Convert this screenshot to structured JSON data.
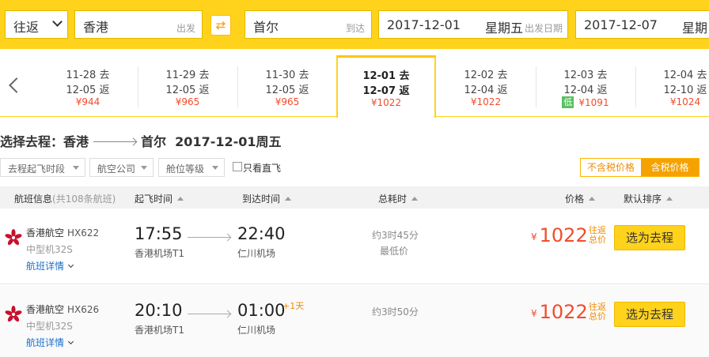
{
  "search": {
    "trip_type": "往返",
    "from_city": "香港",
    "from_hint": "出发",
    "to_city": "首尔",
    "to_hint": "到达",
    "depart_date": "2017-12-01",
    "depart_weekday": "星期五",
    "depart_hint": "出发日期",
    "return_date": "2017-12-07",
    "return_weekday": "星期",
    "colors": {
      "brand": "#ffd21c",
      "price": "#f24c2b",
      "accent": "#f5a200",
      "low_badge": "#5ac061"
    }
  },
  "date_strip": {
    "prev_icon": "chevron-left-icon",
    "cells": [
      {
        "go": "11-28 去",
        "ret": "12-05 返",
        "price": "¥944"
      },
      {
        "go": "11-29 去",
        "ret": "12-05 返",
        "price": "¥965"
      },
      {
        "go": "11-30 去",
        "ret": "12-05 返",
        "price": "¥965"
      },
      {
        "go": "12-01 去",
        "ret": "12-07 返",
        "price": "¥1022",
        "active": true
      },
      {
        "go": "12-02 去",
        "ret": "12-04 返",
        "price": "¥1022"
      },
      {
        "go": "12-03 去",
        "ret": "12-04 返",
        "price": "¥1091",
        "badge": "低"
      },
      {
        "go": "12-04 去",
        "ret": "12-10 返",
        "price": "¥1024"
      }
    ]
  },
  "route": {
    "prefix": "选择去程：香港",
    "to": "首尔",
    "date": "2017-12-01周五"
  },
  "filters": {
    "time": "去程起飞时段",
    "airline": "航空公司",
    "cabin": "舱位等级",
    "direct": "只看直飞",
    "tax_excl": "不含税价格",
    "tax_incl": "含税价格"
  },
  "table_header": {
    "flight": "航班信息",
    "flight_count": "(共108条航班)",
    "depart": "起飞时间",
    "arrive": "到达时间",
    "duration": "总耗时",
    "price": "价格",
    "sort": "默认排序"
  },
  "flights": [
    {
      "airline": "香港航空",
      "flight_no": "HX622",
      "plane": "中型机32S",
      "details": "航班详情",
      "dep_time": "17:55",
      "dep_airport": "香港机场T1",
      "arr_time": "22:40",
      "arr_airport": "仁川机场",
      "plus_day": "",
      "duration": "约3时45分",
      "tag": "最低价",
      "yen": "¥",
      "price": "1022",
      "price_note": "往返总价",
      "button": "选为去程"
    },
    {
      "airline": "香港航空",
      "flight_no": "HX626",
      "plane": "中型机32S",
      "details": "航班详情",
      "dep_time": "20:10",
      "dep_airport": "香港机场T1",
      "arr_time": "01:00",
      "arr_airport": "仁川机场",
      "plus_day": "+1天",
      "duration": "约3时50分",
      "tag": "",
      "yen": "¥",
      "price": "1022",
      "price_note": "往返总价",
      "button": "选为去程"
    }
  ]
}
